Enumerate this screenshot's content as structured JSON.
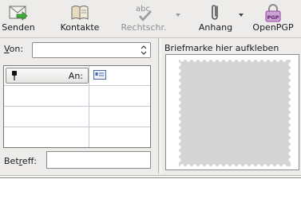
{
  "toolbar": {
    "send": {
      "label": "Senden",
      "icon": "send-icon"
    },
    "contacts": {
      "label": "Kontakte",
      "icon": "address-book-icon"
    },
    "spellcheck": {
      "label": "Rechtschr.",
      "icon": "spellcheck-icon",
      "icon_text": "abc",
      "enabled": false
    },
    "attach": {
      "label": "Anhang",
      "icon": "paperclip-icon"
    },
    "openpgp": {
      "label": "OpenPGP",
      "icon": "openpgp-lock-icon",
      "icon_text": "PGP"
    }
  },
  "header": {
    "from_label": "Von:",
    "from_value": "",
    "recipients": [
      {
        "type": "An:",
        "address": ""
      },
      {
        "type": "",
        "address": ""
      },
      {
        "type": "",
        "address": ""
      },
      {
        "type": "",
        "address": ""
      }
    ],
    "subject_label": "Betreff:",
    "subject_value": ""
  },
  "stamp": {
    "title": "Briefmarke hier aufkleben"
  },
  "colors": {
    "background": "#edeceb",
    "stamp_fill": "#d5d5d5",
    "pgp_accent": "#9b3fa8",
    "grid_line": "#c8c8d4"
  }
}
